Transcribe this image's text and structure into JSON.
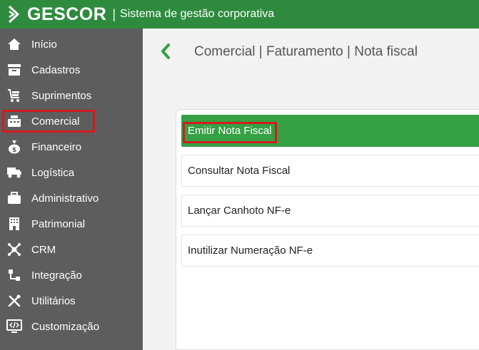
{
  "header": {
    "brand": "GESCOR",
    "separator": "|",
    "subtitle": "Sistema de gestão corporativa",
    "bg_color": "#2e8b3e"
  },
  "sidebar": {
    "bg_color": "#5d5d5d",
    "items": [
      {
        "label": "Início",
        "icon": "home-icon"
      },
      {
        "label": "Cadastros",
        "icon": "archive-icon"
      },
      {
        "label": "Suprimentos",
        "icon": "cart-icon"
      },
      {
        "label": "Comercial",
        "icon": "register-icon",
        "highlighted": true
      },
      {
        "label": "Financeiro",
        "icon": "money-bag-icon"
      },
      {
        "label": "Logística",
        "icon": "truck-icon"
      },
      {
        "label": "Administrativo",
        "icon": "briefcase-icon"
      },
      {
        "label": "Patrimonial",
        "icon": "building-icon"
      },
      {
        "label": "CRM",
        "icon": "network-icon"
      },
      {
        "label": "Integração",
        "icon": "integration-icon"
      },
      {
        "label": "Utilitários",
        "icon": "tools-icon"
      },
      {
        "label": "Customização",
        "icon": "code-monitor-icon"
      }
    ]
  },
  "main": {
    "breadcrumb": "Comercial | Faturamento | Nota fiscal",
    "accent_color": "#35a044",
    "menu": [
      {
        "label": "Emitir Nota Fiscal",
        "active": true,
        "highlighted": true
      },
      {
        "label": "Consultar Nota Fiscal"
      },
      {
        "label": "Lançar Canhoto NF-e"
      },
      {
        "label": "Inutilizar Numeração NF-e"
      }
    ]
  }
}
